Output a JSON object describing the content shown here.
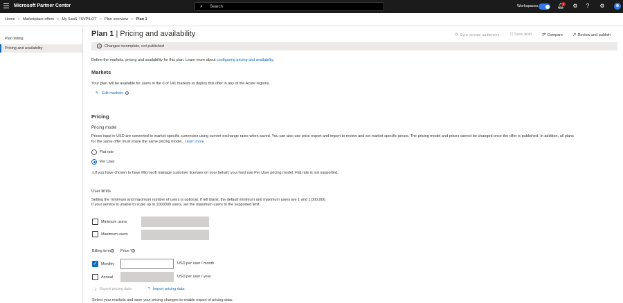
{
  "topbar": {
    "brand": "Microsoft Partner Center",
    "search_placeholder": "Search",
    "workspaces_label": "Workspaces",
    "notification_count": "4"
  },
  "breadcrumb": {
    "items": [
      "Home",
      "Marketplace offers",
      "My SaaS -ISVPILOT",
      "Plan overview",
      "Plan 1"
    ]
  },
  "leftnav": {
    "items": [
      {
        "label": "Plan listing"
      },
      {
        "label": "Pricing and availability"
      }
    ]
  },
  "page": {
    "title_bold": "Plan 1",
    "title_rest": " | Pricing and availability",
    "actions": {
      "sync": "Sync private audiences",
      "save_draft": "Save draft",
      "compare": "Compare",
      "review": "Review and publish"
    },
    "status": "Changes incomplete, not published",
    "intro": "Define the markets, pricing and availability for this plan. Learn more about ",
    "intro_link": "configuring pricing and availability."
  },
  "markets": {
    "heading": "Markets",
    "text": "Your plan will be available for users in the 0 of 141 markets to deploy this offer in any of the Azure regions.",
    "edit_link": "Edit markets"
  },
  "pricing": {
    "heading": "Pricing",
    "model_label": "Pricing model",
    "desc_line1": "Prices input in USD are converted to market-specific currencies using current exchange rates when saved. You can also use price export and import to review and set market specific prices. The pricing model and prices cannot be changed once the offer is published. In addition, all plans",
    "desc_line2": "for the same offer must share the same pricing model.",
    "learn_more": "Learn more",
    "option_flat": "Flat rate",
    "option_per_user": "Per User",
    "selected": "Per User",
    "warning": "If you have chosen to have Microsoft manage customer licenses on your behalf, you must use Per User pricing model. Flat rate is not supported."
  },
  "user_limits": {
    "label": "User limits",
    "desc_line1": "Setting the minimum and maximum number of users is optional. If left blank, the default minimum and maximum users are 1 and 1,000,000.",
    "desc_line2": "If your service is unable to scale up to 1000000 users, set the maximum users to the supported limit.",
    "min_label": "Minimum users",
    "max_label": "Maximum users",
    "min_checked": false,
    "max_checked": false
  },
  "billing": {
    "term_label": "Billing term",
    "price_label": "Price *",
    "monthly_label": "Monthly",
    "monthly_checked": true,
    "monthly_unit": "USD per user / month",
    "annual_label": "Annual",
    "annual_checked": false,
    "annual_unit": "USD per user / year",
    "export_label": "Export pricing data",
    "import_label": "Import pricing data",
    "footer_note": "Select your markets and save your pricing changes to enable export of pricing data."
  },
  "colors": {
    "accent": "#0f6cbd",
    "topbar": "#1b1b1b",
    "status_bg": "#edebe9",
    "badge": "#d42121"
  }
}
